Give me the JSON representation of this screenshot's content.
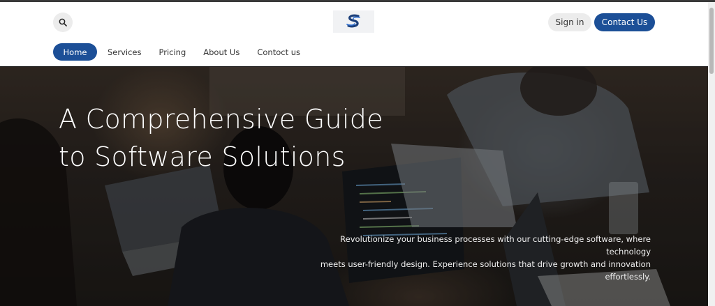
{
  "header": {
    "search_icon": "search-icon",
    "logo_icon": "brand-logo-icon",
    "signin_label": "Sign in",
    "contact_label": "Contact Us"
  },
  "nav": {
    "items": [
      {
        "label": "Home",
        "active": true
      },
      {
        "label": "Services",
        "active": false
      },
      {
        "label": "Pricing",
        "active": false
      },
      {
        "label": "About Us",
        "active": false
      },
      {
        "label": "Contoct us",
        "active": false
      }
    ]
  },
  "hero": {
    "title_line1": "A Comprehensive Guide",
    "title_line2": "to Software Solutions",
    "desc_line1": "Revolutionize your business processes with our cutting-edge software, where technology",
    "desc_line2": "meets user-friendly design. Experience solutions that drive growth and innovation",
    "desc_line3": "effortlessly."
  },
  "colors": {
    "accent": "#1c4f97",
    "header_bg": "#ffffff",
    "pill_bg": "#ececec"
  }
}
